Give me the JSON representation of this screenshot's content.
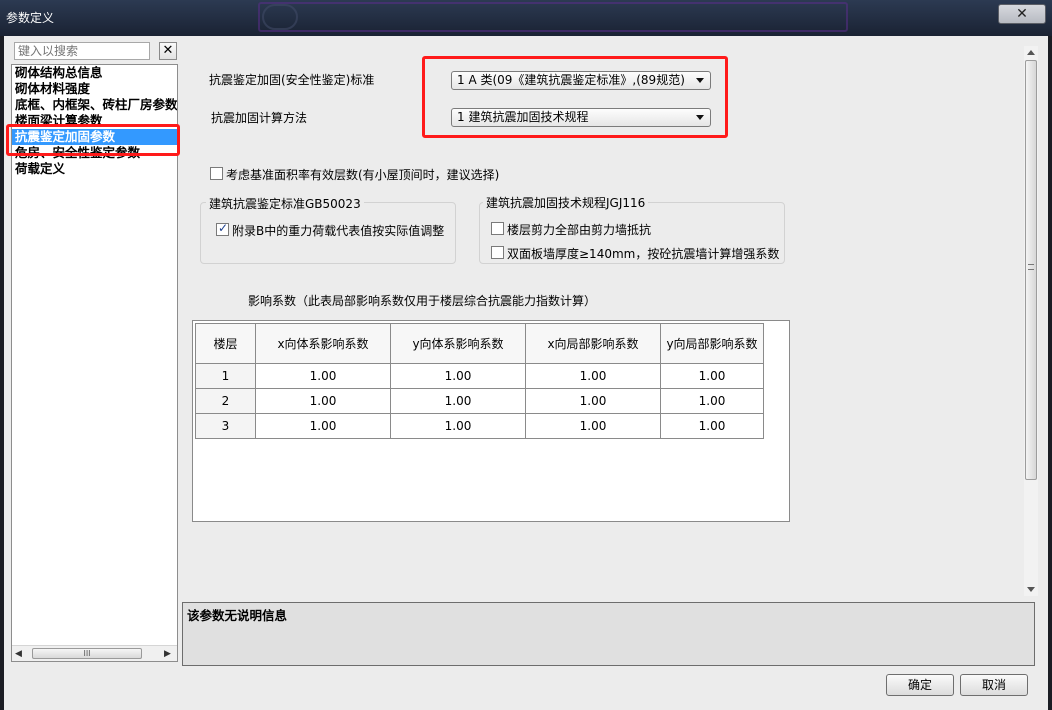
{
  "window": {
    "title": "参数定义",
    "close_glyph": "✕"
  },
  "search": {
    "placeholder": "键入以搜索",
    "clear_glyph": "✕"
  },
  "tree": {
    "items": [
      "砌体结构总信息",
      "砌体材料强度",
      "底框、内框架、砖柱厂房参数",
      "楼面梁计算参数",
      "抗震鉴定加固参数",
      "危房、安全性鉴定参数",
      "荷载定义"
    ],
    "selected_index": 4,
    "scroll_left": "◀",
    "scroll_right": "▶",
    "scroll_grip": "III"
  },
  "form": {
    "standard_label": "抗震鉴定加固(安全性鉴定)标准",
    "standard_value": "1 A 类(09《建筑抗震鉴定标准》,(89规范)",
    "method_label": "抗震加固计算方法",
    "method_value": "1 建筑抗震加固技术规程",
    "consider_area": {
      "label": "考虑基准面积率有效层数(有小屋顶间时，建议选择)",
      "checked": false
    }
  },
  "group_gb": {
    "title": "建筑抗震鉴定标准GB50023",
    "appendix_b": {
      "label": "附录B中的重力荷载代表值按实际值调整",
      "checked": true
    }
  },
  "group_jgj": {
    "title": "建筑抗震加固技术规程JGJ116",
    "shear_wall": {
      "label": "楼层剪力全部由剪力墙抵抗",
      "checked": false
    },
    "double_slab": {
      "label": "双面板墙厚度≥140mm，按砼抗震墙计算增强系数",
      "checked": false
    }
  },
  "table": {
    "caption": "影响系数（此表局部影响系数仅用于楼层综合抗震能力指数计算）",
    "headers": [
      "楼层",
      "x向体系影响系数",
      "y向体系影响系数",
      "x向局部影响系数",
      "y向局部影响系数"
    ],
    "rows": [
      [
        "1",
        "1.00",
        "1.00",
        "1.00",
        "1.00"
      ],
      [
        "2",
        "1.00",
        "1.00",
        "1.00",
        "1.00"
      ],
      [
        "3",
        "1.00",
        "1.00",
        "1.00",
        "1.00"
      ]
    ]
  },
  "description": "该参数无说明信息",
  "buttons": {
    "ok": "确定",
    "cancel": "取消"
  },
  "colors": {
    "highlight": "#ff1a1a",
    "selection": "#3399ff"
  }
}
